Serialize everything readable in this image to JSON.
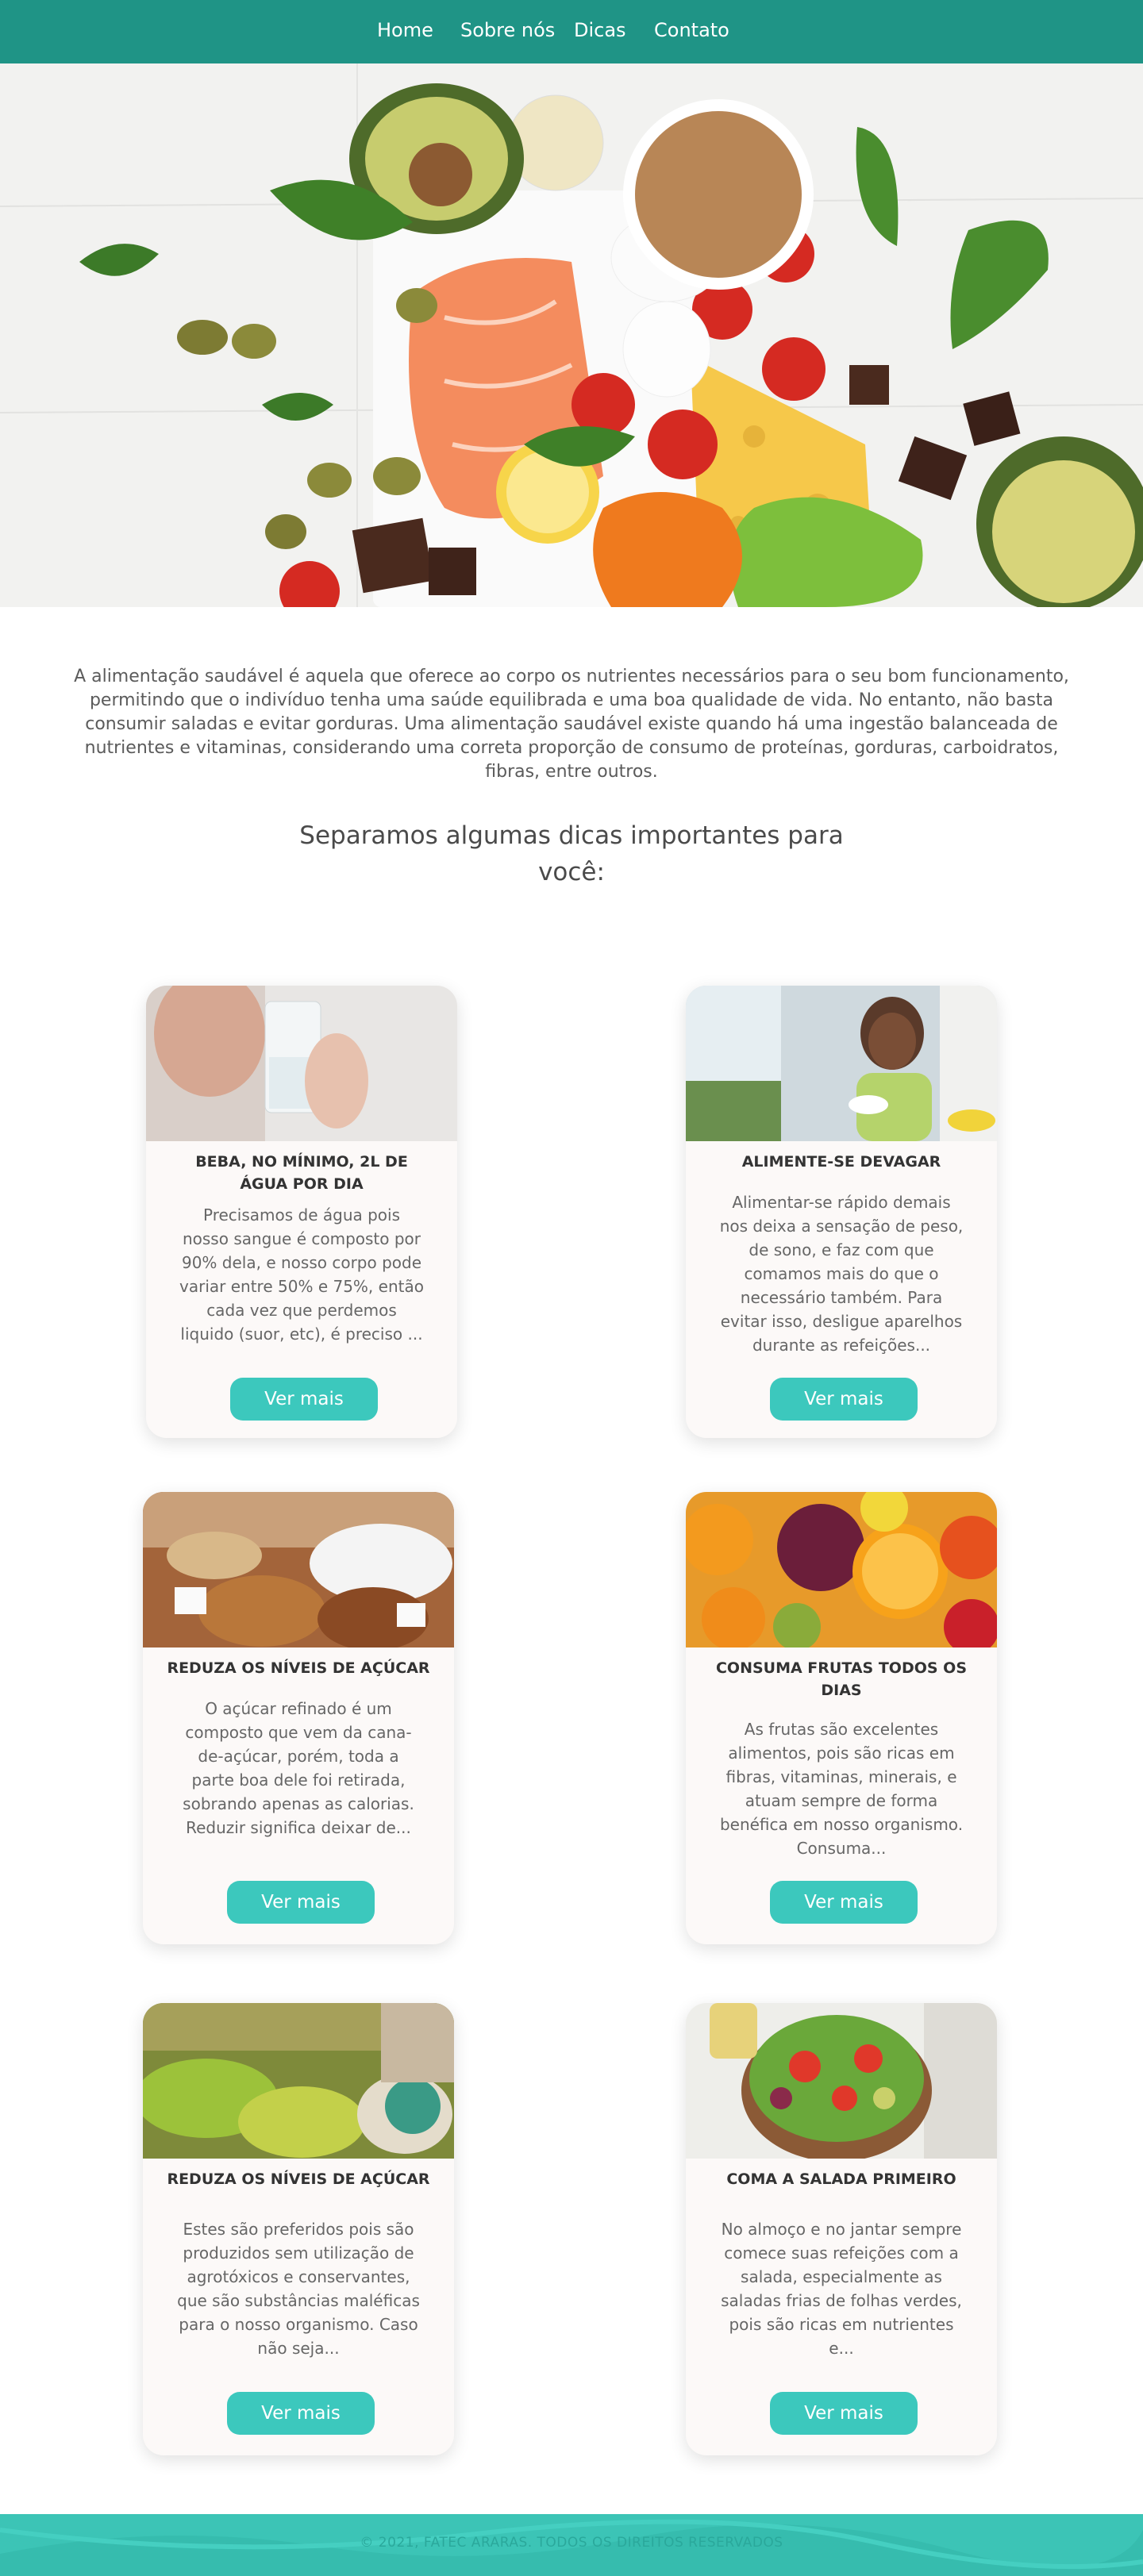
{
  "nav": {
    "items": [
      {
        "label": "Home"
      },
      {
        "label": "Sobre nós"
      },
      {
        "label": "Dicas"
      },
      {
        "label": "Contato"
      }
    ]
  },
  "intro": {
    "text": "A alimentação saudável é aquela que oferece ao corpo os nutrientes necessários para o seu bom funcionamento, permitindo que o indivíduo tenha uma saúde equilibrada e uma boa qualidade de vida. No entanto, não basta consumir saladas e evitar gorduras. Uma alimentação saudável existe quando há uma ingestão balanceada de nutrientes e vitaminas, considerando uma correta proporção de consumo de proteínas, gorduras, carboidratos, fibras, entre outros.",
    "subtitle": "Separamos algumas dicas importantes para você:"
  },
  "cards": [
    {
      "title": "BEBA, NO MÍNIMO, 2L DE ÁGUA POR DIA",
      "text": "Precisamos de água pois nosso sangue é composto por 90% dela, e nosso corpo pode variar entre 50% e 75%, então cada vez que perdemos liquido (suor, etc), é preciso ...",
      "button": "Ver mais"
    },
    {
      "title": "ALIMENTE-SE DEVAGAR",
      "text": "Alimentar-se rápido demais nos deixa a sensação de peso, de sono, e faz com que comamos mais do que o necessário também. Para evitar isso, desligue aparelhos durante as refeições...",
      "button": "Ver mais"
    },
    {
      "title": "REDUZA OS NÍVEIS DE AÇÚCAR",
      "text": "O açúcar refinado é um composto que vem da cana-de-açúcar, porém, toda a parte boa dele foi retirada, sobrando apenas as calorias. Reduzir significa deixar de...",
      "button": "Ver mais"
    },
    {
      "title": "CONSUMA FRUTAS TODOS OS DIAS",
      "text": "As frutas são excelentes alimentos, pois são ricas em fibras, vitaminas, minerais, e atuam sempre de forma benéfica em nosso organismo. Consuma...",
      "button": "Ver mais"
    },
    {
      "title": "REDUZA OS NÍVEIS DE AÇÚCAR",
      "text": "Estes são preferidos pois são produzidos sem utilização de agrotóxicos e conservantes, que são substâncias maléficas para o nosso organismo. Caso não seja...",
      "button": "Ver mais"
    },
    {
      "title": "COMA A SALADA PRIMEIRO",
      "text": "No almoço e no jantar sempre comece suas refeições com a salada, especialmente as saladas frias de folhas verdes, pois são ricas em nutrientes e...",
      "button": "Ver mais"
    }
  ],
  "footer": {
    "text": "© 2021, FATEC ARARAS. TODOS OS DIREITOS RESERVADOS"
  },
  "colors": {
    "nav": "#1f9486",
    "button": "#3cc8bd",
    "footer": "#3cc4b6"
  }
}
